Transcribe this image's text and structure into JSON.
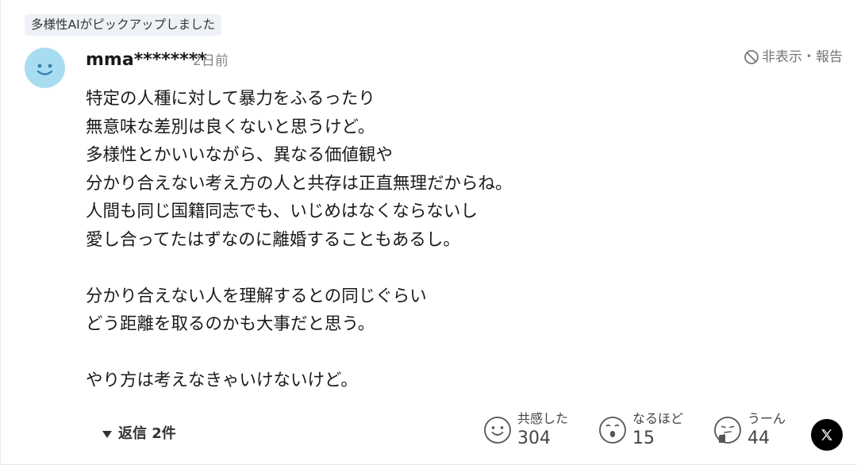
{
  "pickup_badge": "多様性AIがピックアップしました",
  "comment": {
    "username": "mma********",
    "timestamp": "2日前",
    "report_label": "非表示・報告",
    "lines": [
      "特定の人種に対して暴力をふるったり",
      "無意味な差別は良くないと思うけど。",
      "多様性とかいいながら、異なる価値観や",
      "分かり合えない考え方の人と共存は正直無理だからね。",
      "人間も同じ国籍同志でも、いじめはなくならないし",
      "愛し合ってたはずなのに離婚することもあるし。",
      "",
      "分かり合えない人を理解するとの同じぐらい",
      "どう距離を取るのかも大事だと思う。",
      "",
      "やり方は考えなきゃいけないけど。"
    ]
  },
  "replies_label": "返信 2件",
  "reactions": [
    {
      "label": "共感した",
      "count": "304",
      "icon": "smile-face-icon"
    },
    {
      "label": "なるほど",
      "count": "15",
      "icon": "surprised-face-icon"
    },
    {
      "label": "うーん",
      "count": "44",
      "icon": "thinking-face-icon"
    }
  ],
  "share": {
    "icon": "x-logo-icon"
  },
  "colors": {
    "avatar_bg": "#a8dcf0",
    "badge_bg": "#eef2f6",
    "muted_text": "#888888",
    "x_button_bg": "#000000"
  }
}
